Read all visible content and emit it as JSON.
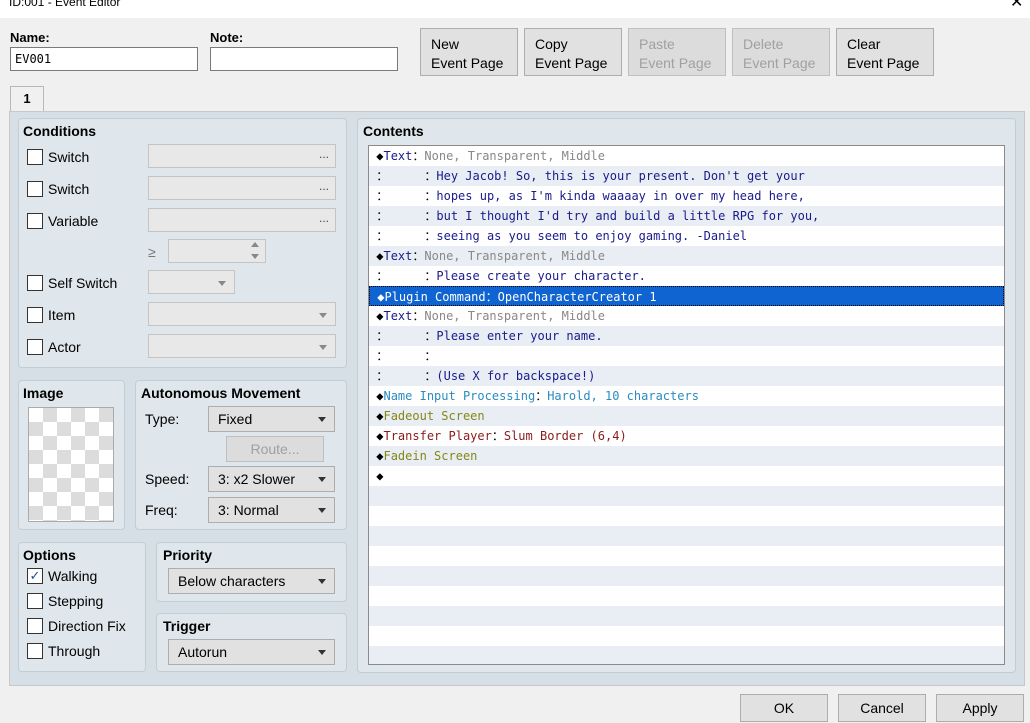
{
  "window": {
    "title": "ID:001 - Event Editor",
    "close": "✕"
  },
  "name_label": "Name:",
  "name_value": "EV001",
  "note_label": "Note:",
  "note_value": "",
  "page_buttons": [
    {
      "line1": "New",
      "line2": "Event Page",
      "enabled": true
    },
    {
      "line1": "Copy",
      "line2": "Event Page",
      "enabled": true
    },
    {
      "line1": "Paste",
      "line2": "Event Page",
      "enabled": false
    },
    {
      "line1": "Delete",
      "line2": "Event Page",
      "enabled": false
    },
    {
      "line1": "Clear",
      "line2": "Event Page",
      "enabled": true
    }
  ],
  "tab_label": "1",
  "conditions": {
    "title": "Conditions",
    "switch1": "Switch",
    "switch2": "Switch",
    "variable": "Variable",
    "gte": "≥",
    "self_switch": "Self Switch",
    "item": "Item",
    "actor": "Actor",
    "dots": "..."
  },
  "image": {
    "title": "Image"
  },
  "movement": {
    "title": "Autonomous Movement",
    "type_label": "Type:",
    "type_value": "Fixed",
    "route_label": "Route...",
    "speed_label": "Speed:",
    "speed_value": "3: x2 Slower",
    "freq_label": "Freq:",
    "freq_value": "3: Normal"
  },
  "options": {
    "title": "Options",
    "walking": "Walking",
    "walking_checked": true,
    "stepping": "Stepping",
    "direction_fix": "Direction Fix",
    "through": "Through",
    "check_glyph": "✓"
  },
  "priority": {
    "title": "Priority",
    "value": "Below characters"
  },
  "trigger": {
    "title": "Trigger",
    "value": "Autorun"
  },
  "contents": {
    "title": "Contents",
    "rows": [
      {
        "prefix": "◆",
        "cmd": "Text",
        "sep": "：",
        "arg": "None, Transparent, Middle",
        "cmd_color": "c-text",
        "arg_color": "c-grey"
      },
      {
        "prefix": "：",
        "cmd": "",
        "sep": "     ：",
        "arg": "Hey Jacob! So, this is your present. Don't get your",
        "cmd_color": "c-text",
        "arg_color": "c-navy"
      },
      {
        "prefix": "：",
        "cmd": "",
        "sep": "     ：",
        "arg": "hopes up, as I'm kinda waaaay in over my head here,",
        "cmd_color": "c-text",
        "arg_color": "c-navy"
      },
      {
        "prefix": "：",
        "cmd": "",
        "sep": "     ：",
        "arg": "but I thought I'd try and build a little RPG for you,",
        "cmd_color": "c-text",
        "arg_color": "c-navy"
      },
      {
        "prefix": "：",
        "cmd": "",
        "sep": "     ：",
        "arg": "seeing as you seem to enjoy gaming. -Daniel",
        "cmd_color": "c-text",
        "arg_color": "c-navy"
      },
      {
        "prefix": "◆",
        "cmd": "Text",
        "sep": "：",
        "arg": "None, Transparent, Middle",
        "cmd_color": "c-text",
        "arg_color": "c-grey"
      },
      {
        "prefix": "：",
        "cmd": "",
        "sep": "     ：",
        "arg": "Please create your character.",
        "cmd_color": "c-text",
        "arg_color": "c-navy"
      },
      {
        "prefix": "◆",
        "cmd": "Plugin Command",
        "sep": "：",
        "arg": "OpenCharacterCreator 1",
        "cmd_color": "c-white",
        "arg_color": "c-white",
        "selected": true
      },
      {
        "prefix": "◆",
        "cmd": "Text",
        "sep": "：",
        "arg": "None, Transparent, Middle",
        "cmd_color": "c-text",
        "arg_color": "c-grey"
      },
      {
        "prefix": "：",
        "cmd": "",
        "sep": "     ：",
        "arg": "Please enter your name.",
        "cmd_color": "c-text",
        "arg_color": "c-navy"
      },
      {
        "prefix": "：",
        "cmd": "",
        "sep": "     ：",
        "arg": "",
        "cmd_color": "c-text",
        "arg_color": "c-navy"
      },
      {
        "prefix": "：",
        "cmd": "",
        "sep": "     ：",
        "arg": "(Use X for backspace!)",
        "cmd_color": "c-text",
        "arg_color": "c-navy"
      },
      {
        "prefix": "◆",
        "cmd": "Name Input Processing",
        "sep": "：",
        "arg": "Harold, 10 characters",
        "cmd_color": "c-cyan",
        "arg_color": "c-cyan"
      },
      {
        "prefix": "◆",
        "cmd": "Fadeout Screen",
        "sep": "",
        "arg": "",
        "cmd_color": "c-olive",
        "arg_color": "c-olive"
      },
      {
        "prefix": "◆",
        "cmd": "Transfer Player",
        "sep": "：",
        "arg": "Slum Border (6,4)",
        "cmd_color": "c-red",
        "arg_color": "c-red"
      },
      {
        "prefix": "◆",
        "cmd": "Fadein Screen",
        "sep": "",
        "arg": "",
        "cmd_color": "c-olive",
        "arg_color": "c-olive"
      },
      {
        "prefix": "◆",
        "cmd": "",
        "sep": "",
        "arg": "",
        "cmd_color": "c-text",
        "arg_color": "c-text"
      }
    ]
  },
  "footer": {
    "ok": "OK",
    "cancel": "Cancel",
    "apply": "Apply"
  }
}
